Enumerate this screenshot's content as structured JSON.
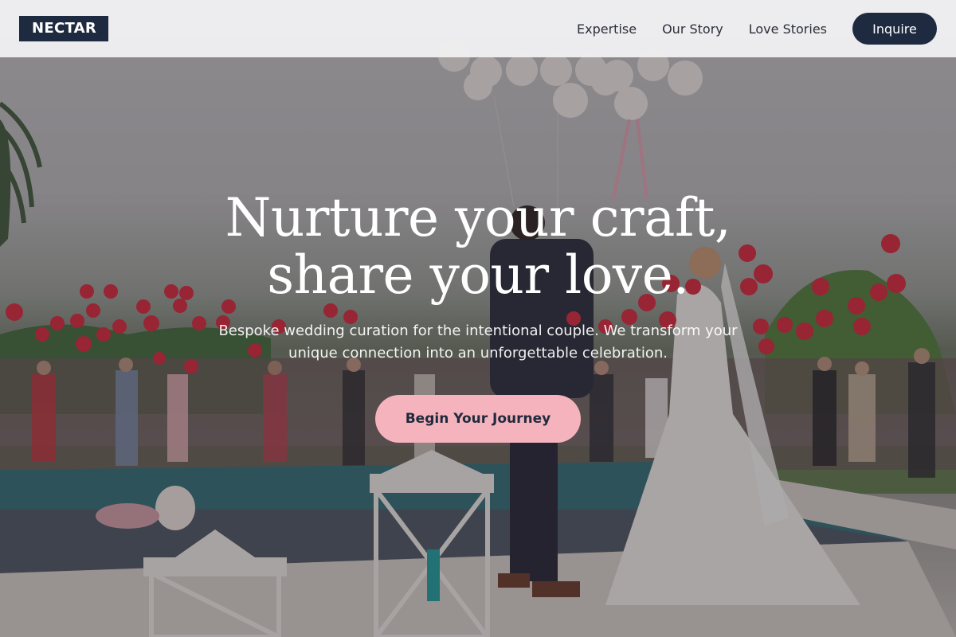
{
  "brand": {
    "logo_text": "NECTAR"
  },
  "nav": {
    "links": [
      "Expertise",
      "Our Story",
      "Love Stories"
    ],
    "cta_label": "Inquire"
  },
  "hero": {
    "headline_line1": "Nurture your craft,",
    "headline_line2": "share your love.",
    "subheadline": "Bespoke wedding curation for the intentional couple. We transform your unique connection into an unforgettable celebration.",
    "cta_label": "Begin Your Journey"
  },
  "colors": {
    "navy": "#1e2a40",
    "blush": "#f4b3bd",
    "nav_background": "#f0f0f1",
    "balloon_red": "#d8263a",
    "balloon_white": "#f3efeb"
  }
}
